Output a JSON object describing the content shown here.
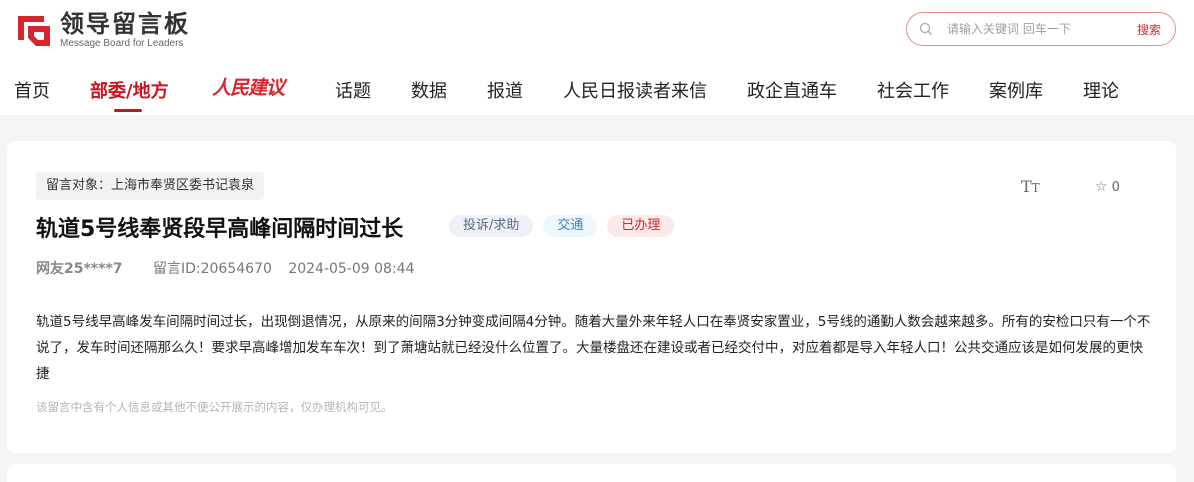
{
  "header": {
    "logo_title": "领导留言板",
    "logo_subtitle": "Message Board for Leaders",
    "search_placeholder": "请输入关键词 回车一下",
    "search_button": "搜索"
  },
  "nav": {
    "items": [
      {
        "label": "首页"
      },
      {
        "label": "部委/地方"
      },
      {
        "label": "人民建议"
      },
      {
        "label": "话题"
      },
      {
        "label": "数据"
      },
      {
        "label": "报道"
      },
      {
        "label": "人民日报读者来信"
      },
      {
        "label": "政企直通车"
      },
      {
        "label": "社会工作"
      },
      {
        "label": "案例库"
      },
      {
        "label": "理论"
      }
    ],
    "active_index": 1
  },
  "message": {
    "target": "留言对象：上海市奉贤区委书记袁泉",
    "font_toggle": "TT",
    "favorite_count": "0",
    "title": "轨道5号线奉贤段早高峰间隔时间过长",
    "tags": {
      "type": "投诉/求助",
      "category": "交通",
      "status": "已办理"
    },
    "author": "网友25****7",
    "message_id": "留言ID:20654670",
    "datetime": "2024-05-09 08:44",
    "content": "轨道5号线早高峰发车间隔时间过长，出现倒退情况，从原来的间隔3分钟变成间隔4分钟。随着大量外来年轻人口在奉贤安家置业，5号线的通勤人数会越来越多。所有的安检口只有一个不说了，发车时间还隔那么久！要求早高峰增加发车车次！到了萧塘站就已经没什么位置了。大量楼盘还在建设或者已经交付中，对应着都是导入年轻人口！公共交通应该是如何发展的更快捷",
    "notice": "该留言中含有个人信息或其他不便公开展示的内容，仅办理机构可见。"
  },
  "colors": {
    "brand_red": "#c8141e",
    "page_bg": "#f4f5f7"
  }
}
